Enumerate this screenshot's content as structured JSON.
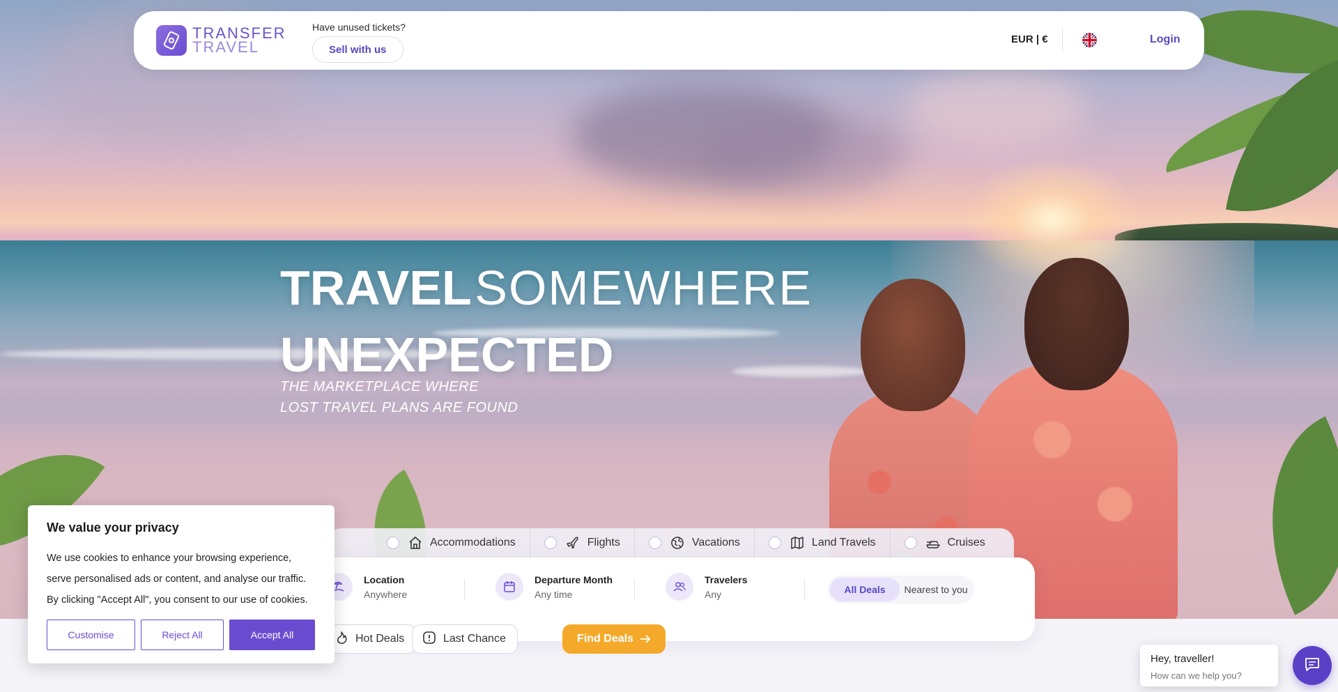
{
  "header": {
    "logo_line1": "TRANSFER",
    "logo_line2": "TRAVEL",
    "have_tickets": "Have unused tickets?",
    "sell_label": "Sell with us",
    "currency": "EUR | €",
    "login_label": "Login"
  },
  "hero": {
    "title_bold": "TRAVEL",
    "title_light": "SOMEWHERE",
    "title_line2": "UNEXPECTED",
    "subtitle_line1": "THE MARKETPLACE WHERE",
    "subtitle_line2": "LOST TRAVEL PLANS ARE FOUND"
  },
  "categories": [
    {
      "label": "Accommodations",
      "icon": "house-icon"
    },
    {
      "label": "Flights",
      "icon": "plane-icon"
    },
    {
      "label": "Vacations",
      "icon": "globe-icon"
    },
    {
      "label": "Land Travels",
      "icon": "map-icon"
    },
    {
      "label": "Cruises",
      "icon": "ship-icon"
    }
  ],
  "search": {
    "location_title": "Location",
    "location_value": "Anywhere",
    "departure_title": "Departure Month",
    "departure_value": "Any time",
    "travelers_title": "Travelers",
    "travelers_value": "Any",
    "toggle_all": "All Deals",
    "toggle_nearest": "Nearest to you",
    "chip_hot": "Hot Deals",
    "chip_last": "Last Chance",
    "find_label": "Find Deals"
  },
  "cookie": {
    "title": "We value your privacy",
    "body": "We use cookies to enhance your browsing experience, serve personalised ads or content, and analyse our traffic. By clicking \"Accept All\", you consent to our use of cookies.",
    "customise": "Customise",
    "reject": "Reject All",
    "accept": "Accept All"
  },
  "chat": {
    "greeting": "Hey, traveller!",
    "prompt": "How can we help you?"
  },
  "colors": {
    "brand_purple": "#5a47c2",
    "accent_orange": "#f5a92a",
    "cookie_purple": "#6a4cd1"
  }
}
